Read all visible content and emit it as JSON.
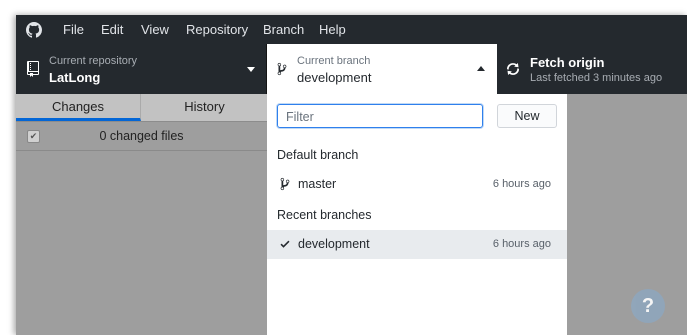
{
  "menubar": {
    "items": [
      "File",
      "Edit",
      "View",
      "Repository",
      "Branch",
      "Help"
    ]
  },
  "toolbar": {
    "repo_label": "Current repository",
    "repo_value": "LatLong",
    "branch_label": "Current branch",
    "branch_value": "development",
    "fetch_title": "Fetch origin",
    "fetch_subtitle": "Last fetched 3 minutes ago"
  },
  "tabs": {
    "changes": "Changes",
    "history": "History"
  },
  "changes": {
    "summary": "0 changed files"
  },
  "branch_popup": {
    "filter_placeholder": "Filter",
    "new_button": "New",
    "default_header": "Default branch",
    "recent_header": "Recent branches",
    "default_branches": [
      {
        "name": "master",
        "time": "6 hours ago"
      }
    ],
    "recent_branches": [
      {
        "name": "development",
        "time": "6 hours ago",
        "selected": true
      }
    ]
  },
  "colors": {
    "chrome": "#24292e",
    "accent": "#0366d6",
    "overlay": "#9e9e9e"
  },
  "icons": {
    "app": "github-icon",
    "repo": "repo-icon",
    "branch": "branch-icon",
    "fetch": "sync-icon",
    "selected": "check-icon",
    "help": "help-icon"
  }
}
